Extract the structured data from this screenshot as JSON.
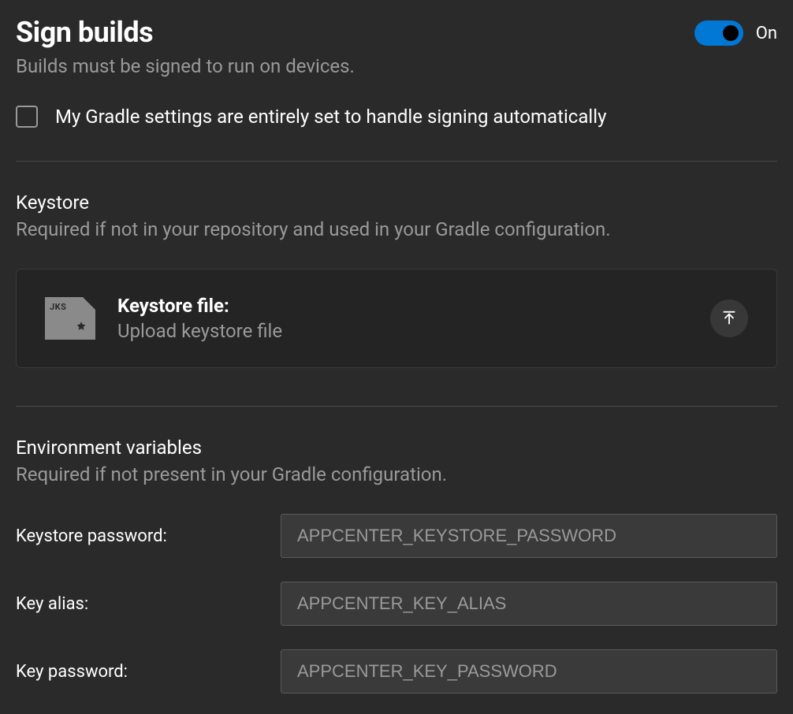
{
  "header": {
    "title": "Sign builds",
    "subtitle": "Builds must be signed to run on devices.",
    "toggleLabel": "On",
    "toggleOn": true
  },
  "checkbox": {
    "label": "My Gradle settings are entirely set to handle signing automatically",
    "checked": false
  },
  "keystore": {
    "title": "Keystore",
    "description": "Required if not in your repository and used in your Gradle configuration.",
    "fileLabel": "JKS",
    "uploadTitle": "Keystore file:",
    "uploadSubtitle": "Upload keystore file"
  },
  "envVars": {
    "title": "Environment variables",
    "description": "Required if not present in your Gradle configuration.",
    "fields": {
      "keystorePassword": {
        "label": "Keystore password:",
        "placeholder": "APPCENTER_KEYSTORE_PASSWORD",
        "value": ""
      },
      "keyAlias": {
        "label": "Key alias:",
        "placeholder": "APPCENTER_KEY_ALIAS",
        "value": ""
      },
      "keyPassword": {
        "label": "Key password:",
        "placeholder": "APPCENTER_KEY_PASSWORD",
        "value": ""
      }
    }
  }
}
